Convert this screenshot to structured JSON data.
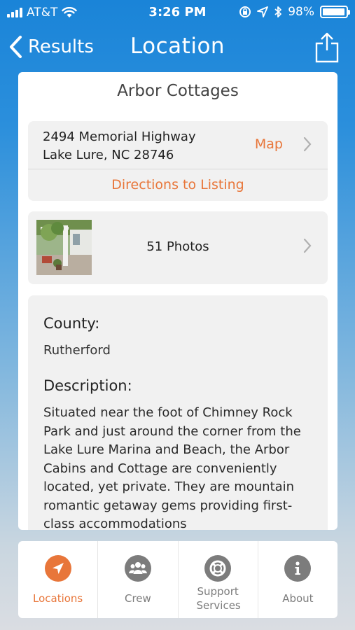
{
  "status_bar": {
    "carrier": "AT&T",
    "time": "3:26 PM",
    "battery": "98%",
    "battery_level": 0.98
  },
  "nav": {
    "back_label": "Results",
    "title": "Location"
  },
  "listing": {
    "name": "Arbor Cottages",
    "address_line1": "2494 Memorial Highway",
    "address_line2": "Lake Lure, NC 28746",
    "map_label": "Map",
    "directions_label": "Directions to Listing",
    "photos_label": "51 Photos",
    "county_label": "County:",
    "county_value": "Rutherford",
    "description_label": "Description:",
    "description": "Situated near the foot of Chimney Rock Park and just around the corner from the Lake Lure Marina and Beach, the Arbor Cabins and Cottage are conveniently located, yet private. They are mountain romantic getaway gems providing first-class accommodations"
  },
  "tabs": [
    {
      "label": "Locations",
      "icon": "navigation-arrow-icon",
      "active": true
    },
    {
      "label": "Crew",
      "icon": "group-icon",
      "active": false
    },
    {
      "label": "Support Services",
      "icon": "lifebuoy-icon",
      "active": false
    },
    {
      "label": "About",
      "icon": "info-icon",
      "active": false
    }
  ],
  "colors": {
    "accent": "#e8763a",
    "header": "#1a84d8",
    "inactive_tab": "#7c7c7c"
  }
}
